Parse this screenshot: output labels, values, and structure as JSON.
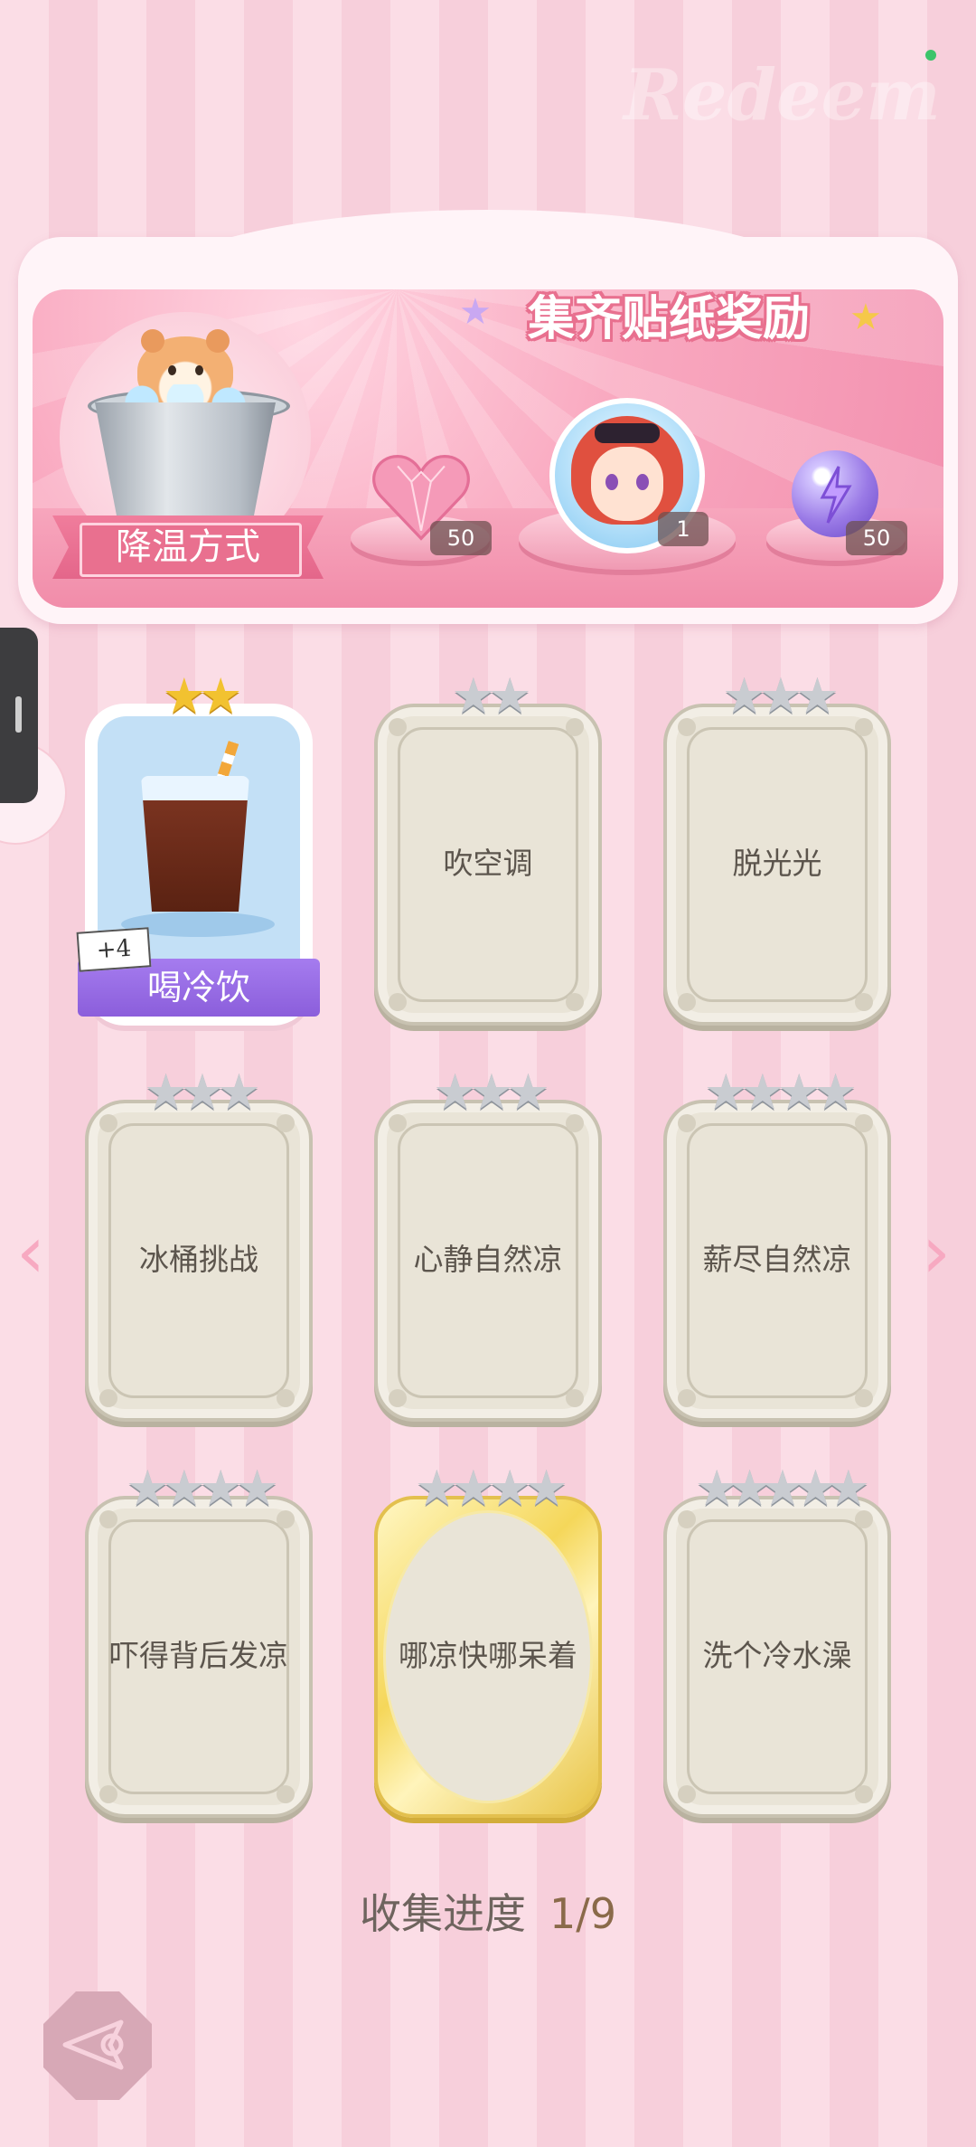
{
  "banner": {
    "title": "集齐贴纸奖励",
    "watermark": "Redeem",
    "mode_label": "降温方式",
    "rewards": [
      {
        "icon": "pink-heart-gem-icon",
        "count": "50"
      },
      {
        "icon": "character-avatar-icon",
        "count": "1"
      },
      {
        "icon": "purple-lightning-orb-icon",
        "count": "50"
      }
    ]
  },
  "cards": [
    {
      "label": "喝冷饮",
      "stars": "★★",
      "obtained": true,
      "bonus": "+4"
    },
    {
      "label": "吹空调",
      "stars": "★★"
    },
    {
      "label": "脱光光",
      "stars": "★★★"
    },
    {
      "label": "冰桶挑战",
      "stars": "★★★"
    },
    {
      "label": "心静自然凉",
      "stars": "★★★"
    },
    {
      "label": "薪尽自然凉",
      "stars": "★★★★"
    },
    {
      "label": "吓得背后发凉",
      "stars": "★★★★"
    },
    {
      "label": "哪凉快哪呆着",
      "stars": "★★★★"
    },
    {
      "label": "洗个冷水澡",
      "stars": "★★★★★"
    }
  ],
  "nav": {
    "prev": "‹",
    "next": "›"
  },
  "progress": {
    "label": "收集进度",
    "value": "1/9"
  },
  "colors": {
    "accent": "#f28fae",
    "obtained_ribbon": "#8b5edb",
    "star_gold": "#f2c230",
    "star_silver": "#c9ccd1"
  }
}
